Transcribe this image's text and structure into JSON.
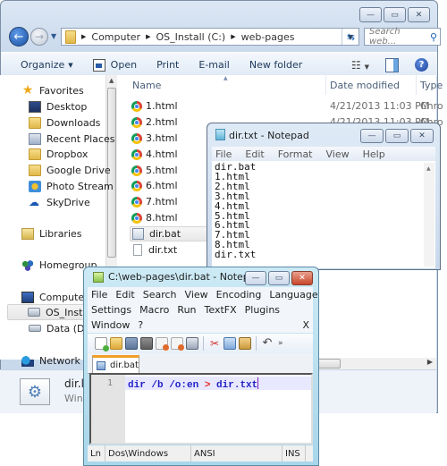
{
  "explorer": {
    "caption_buttons": {
      "minimize": "—",
      "maximize": "▭",
      "close": "✕"
    },
    "address": {
      "segments": [
        "Computer",
        "OS_Install (C:)",
        "web-pages"
      ]
    },
    "search_placeholder": "Search web...",
    "commands": [
      {
        "label": "Organize",
        "dropdown": true
      },
      {
        "label": "Open",
        "icon": "open-icon"
      },
      {
        "label": "Print"
      },
      {
        "label": "E-mail"
      },
      {
        "label": "New folder"
      }
    ],
    "nav": {
      "favorites": "Favorites",
      "favorites_items": [
        "Desktop",
        "Downloads",
        "Recent Places",
        "Dropbox",
        "Google Drive",
        "Photo Stream",
        "SkyDrive"
      ],
      "libraries": "Libraries",
      "homegroup": "Homegroup",
      "computer": "Computer",
      "computer_items": [
        "OS_Install",
        "Data (D:)"
      ],
      "network": "Network"
    },
    "columns": {
      "name": "Name",
      "date": "Date modified",
      "type": "Type"
    },
    "files": [
      {
        "name": "1.html",
        "date": "4/21/2013 11:03 PM",
        "type": "Chro",
        "icon": "chrome-icon"
      },
      {
        "name": "2.html",
        "date": "4/21/2013 11:03 PM",
        "type": "Chro",
        "icon": "chrome-icon"
      },
      {
        "name": "3.html",
        "icon": "chrome-icon"
      },
      {
        "name": "4.html",
        "icon": "chrome-icon"
      },
      {
        "name": "5.html",
        "icon": "chrome-icon"
      },
      {
        "name": "6.html",
        "icon": "chrome-icon"
      },
      {
        "name": "7.html",
        "icon": "chrome-icon"
      },
      {
        "name": "8.html",
        "icon": "chrome-icon"
      },
      {
        "name": "dir.bat",
        "icon": "batch-file-icon",
        "selected": true
      },
      {
        "name": "dir.txt",
        "icon": "text-file-icon"
      }
    ],
    "details": {
      "name": "dir.l",
      "type": "Wind"
    }
  },
  "notepad": {
    "title": "dir.txt - Notepad",
    "menu": [
      "File",
      "Edit",
      "Format",
      "View",
      "Help"
    ],
    "content": "dir.bat\n1.html\n2.html\n3.html\n4.html\n5.html\n6.html\n7.html\n8.html\ndir.txt"
  },
  "npp": {
    "title": "C:\\web-pages\\dir.bat - Notepa...",
    "menu_row1": [
      "File",
      "Edit",
      "Search",
      "View",
      "Encoding",
      "Language"
    ],
    "menu_row2": [
      "Settings",
      "Macro",
      "Run",
      "TextFX",
      "Plugins"
    ],
    "menu_row3": [
      "Window",
      "?"
    ],
    "menu_close": "X",
    "tab": "dir.bat",
    "line_number": "1",
    "code": {
      "cmd": "dir /b /o:en ",
      "op": ">",
      "target": " dir.txt"
    },
    "status": [
      "Ln",
      "Dos\\Windows",
      "ANSI",
      "INS"
    ]
  }
}
